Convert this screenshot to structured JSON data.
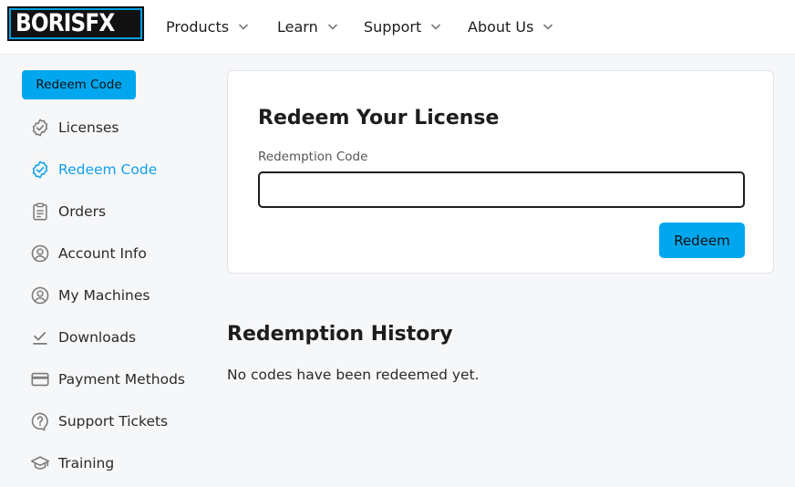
{
  "header": {
    "logo_text": "BORISFX",
    "nav": [
      {
        "label": "Products",
        "icon": "chevron-down-icon"
      },
      {
        "label": "Learn",
        "icon": "chevron-down-icon"
      },
      {
        "label": "Support",
        "icon": "chevron-down-icon"
      },
      {
        "label": "About Us",
        "icon": "chevron-down-icon"
      }
    ]
  },
  "sidebar": {
    "primary_button": "Redeem Code",
    "items": [
      {
        "label": "Licenses",
        "icon": "badge-check-icon"
      },
      {
        "label": "Redeem Code",
        "icon": "badge-check-icon",
        "active": true
      },
      {
        "label": "Orders",
        "icon": "clipboard-icon"
      },
      {
        "label": "Account Info",
        "icon": "user-circle-icon"
      },
      {
        "label": "My Machines",
        "icon": "user-circle-icon"
      },
      {
        "label": "Downloads",
        "icon": "download-check-icon"
      },
      {
        "label": "Payment Methods",
        "icon": "credit-card-icon"
      },
      {
        "label": "Support Tickets",
        "icon": "question-bubble-icon"
      },
      {
        "label": "Training",
        "icon": "graduation-cap-icon"
      }
    ]
  },
  "redeem": {
    "title": "Redeem Your License",
    "field_label": "Redemption Code",
    "field_value": "",
    "button": "Redeem"
  },
  "history": {
    "title": "Redemption History",
    "empty_text": "No codes have been redeemed yet."
  },
  "colors": {
    "accent": "#00a7ee",
    "active_text": "#12a1e6",
    "logo_blue": "#00a0e3",
    "icon_gray": "#7a7a7a"
  }
}
